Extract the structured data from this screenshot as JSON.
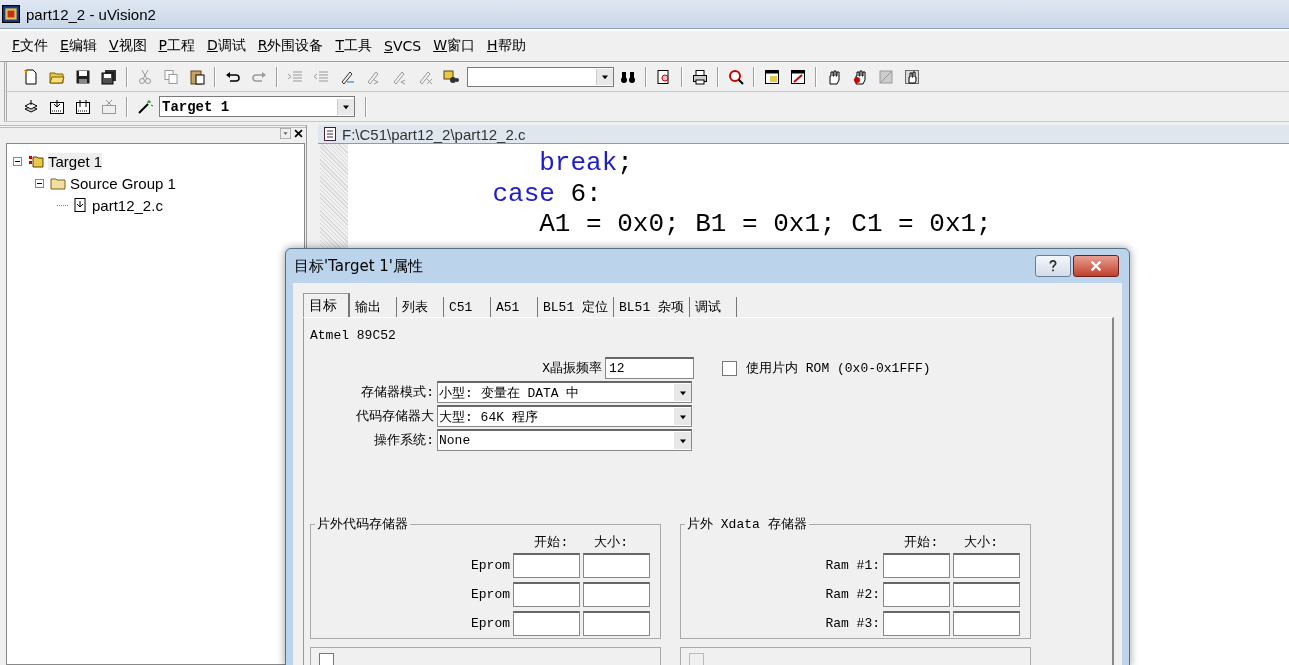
{
  "window": {
    "title": "part12_2  - uVision2"
  },
  "menu": [
    {
      "label": "F文件"
    },
    {
      "label": "E编辑"
    },
    {
      "label": "V视图"
    },
    {
      "label": "P工程"
    },
    {
      "label": "D调试"
    },
    {
      "label": "R外围设备"
    },
    {
      "label": "T工具"
    },
    {
      "label": "SVCS"
    },
    {
      "label": "W窗口"
    },
    {
      "label": "H帮助"
    }
  ],
  "target_select": {
    "value": "Target 1"
  },
  "project_tree": [
    {
      "label": "Target 1",
      "expanded": true,
      "selected": true,
      "kind": "target",
      "children": [
        {
          "label": "Source Group 1",
          "expanded": true,
          "selected": false,
          "kind": "group",
          "children": [
            {
              "label": "part12_2.c",
              "selected": false,
              "kind": "file"
            }
          ]
        }
      ]
    }
  ],
  "editor": {
    "path": "F:\\C51\\part12_2\\part12_2.c",
    "lines": [
      {
        "tokens": [
          {
            "kind": "keyword",
            "text": "            break"
          },
          {
            "kind": "plain",
            "text": ";"
          }
        ]
      },
      {
        "tokens": [
          {
            "kind": "keyword",
            "text": "         case"
          },
          {
            "kind": "plain",
            "text": " 6:"
          }
        ]
      },
      {
        "tokens": [
          {
            "kind": "plain",
            "text": "            A1 = 0x0; B1 = 0x1; C1 = 0x1;"
          }
        ]
      }
    ]
  },
  "dialog": {
    "title": "目标'Target 1'属性",
    "tabs": [
      {
        "label": "目标",
        "selected": true
      },
      {
        "label": "输出",
        "selected": false
      },
      {
        "label": "列表",
        "selected": false
      },
      {
        "label": "C51",
        "selected": false
      },
      {
        "label": "A51",
        "selected": false
      },
      {
        "label": "BL51 定位",
        "selected": false
      },
      {
        "label": "BL51 杂项",
        "selected": false
      },
      {
        "label": "调试",
        "selected": false
      }
    ],
    "device": "Atmel 89C52",
    "xtal": {
      "label": "X晶振频率",
      "value": "12"
    },
    "onchip_rom": {
      "label": "使用片内 ROM (0x0-0x1FFF)",
      "checked": false
    },
    "selects": [
      {
        "label": "存储器模式:",
        "value": "小型: 变量在 DATA 中"
      },
      {
        "label": "代码存储器大",
        "value": "大型: 64K 程序"
      },
      {
        "label": "操作系统:",
        "value": "None"
      }
    ],
    "groups": [
      {
        "title": "片外代码存储器",
        "start_header": "开始:",
        "size_header": "大小:",
        "rows": [
          {
            "label": "Eprom"
          },
          {
            "label": "Eprom"
          },
          {
            "label": "Eprom"
          }
        ]
      },
      {
        "title": "片外 Xdata 存储器",
        "start_header": "开始:",
        "size_header": "大小:",
        "rows": [
          {
            "label": "Ram #1:"
          },
          {
            "label": "Ram #2:"
          },
          {
            "label": "Ram #3:"
          }
        ]
      }
    ],
    "bottom_groups": [
      {
        "checked": false,
        "disabled": false
      },
      {
        "checked": false,
        "disabled": true
      }
    ]
  }
}
